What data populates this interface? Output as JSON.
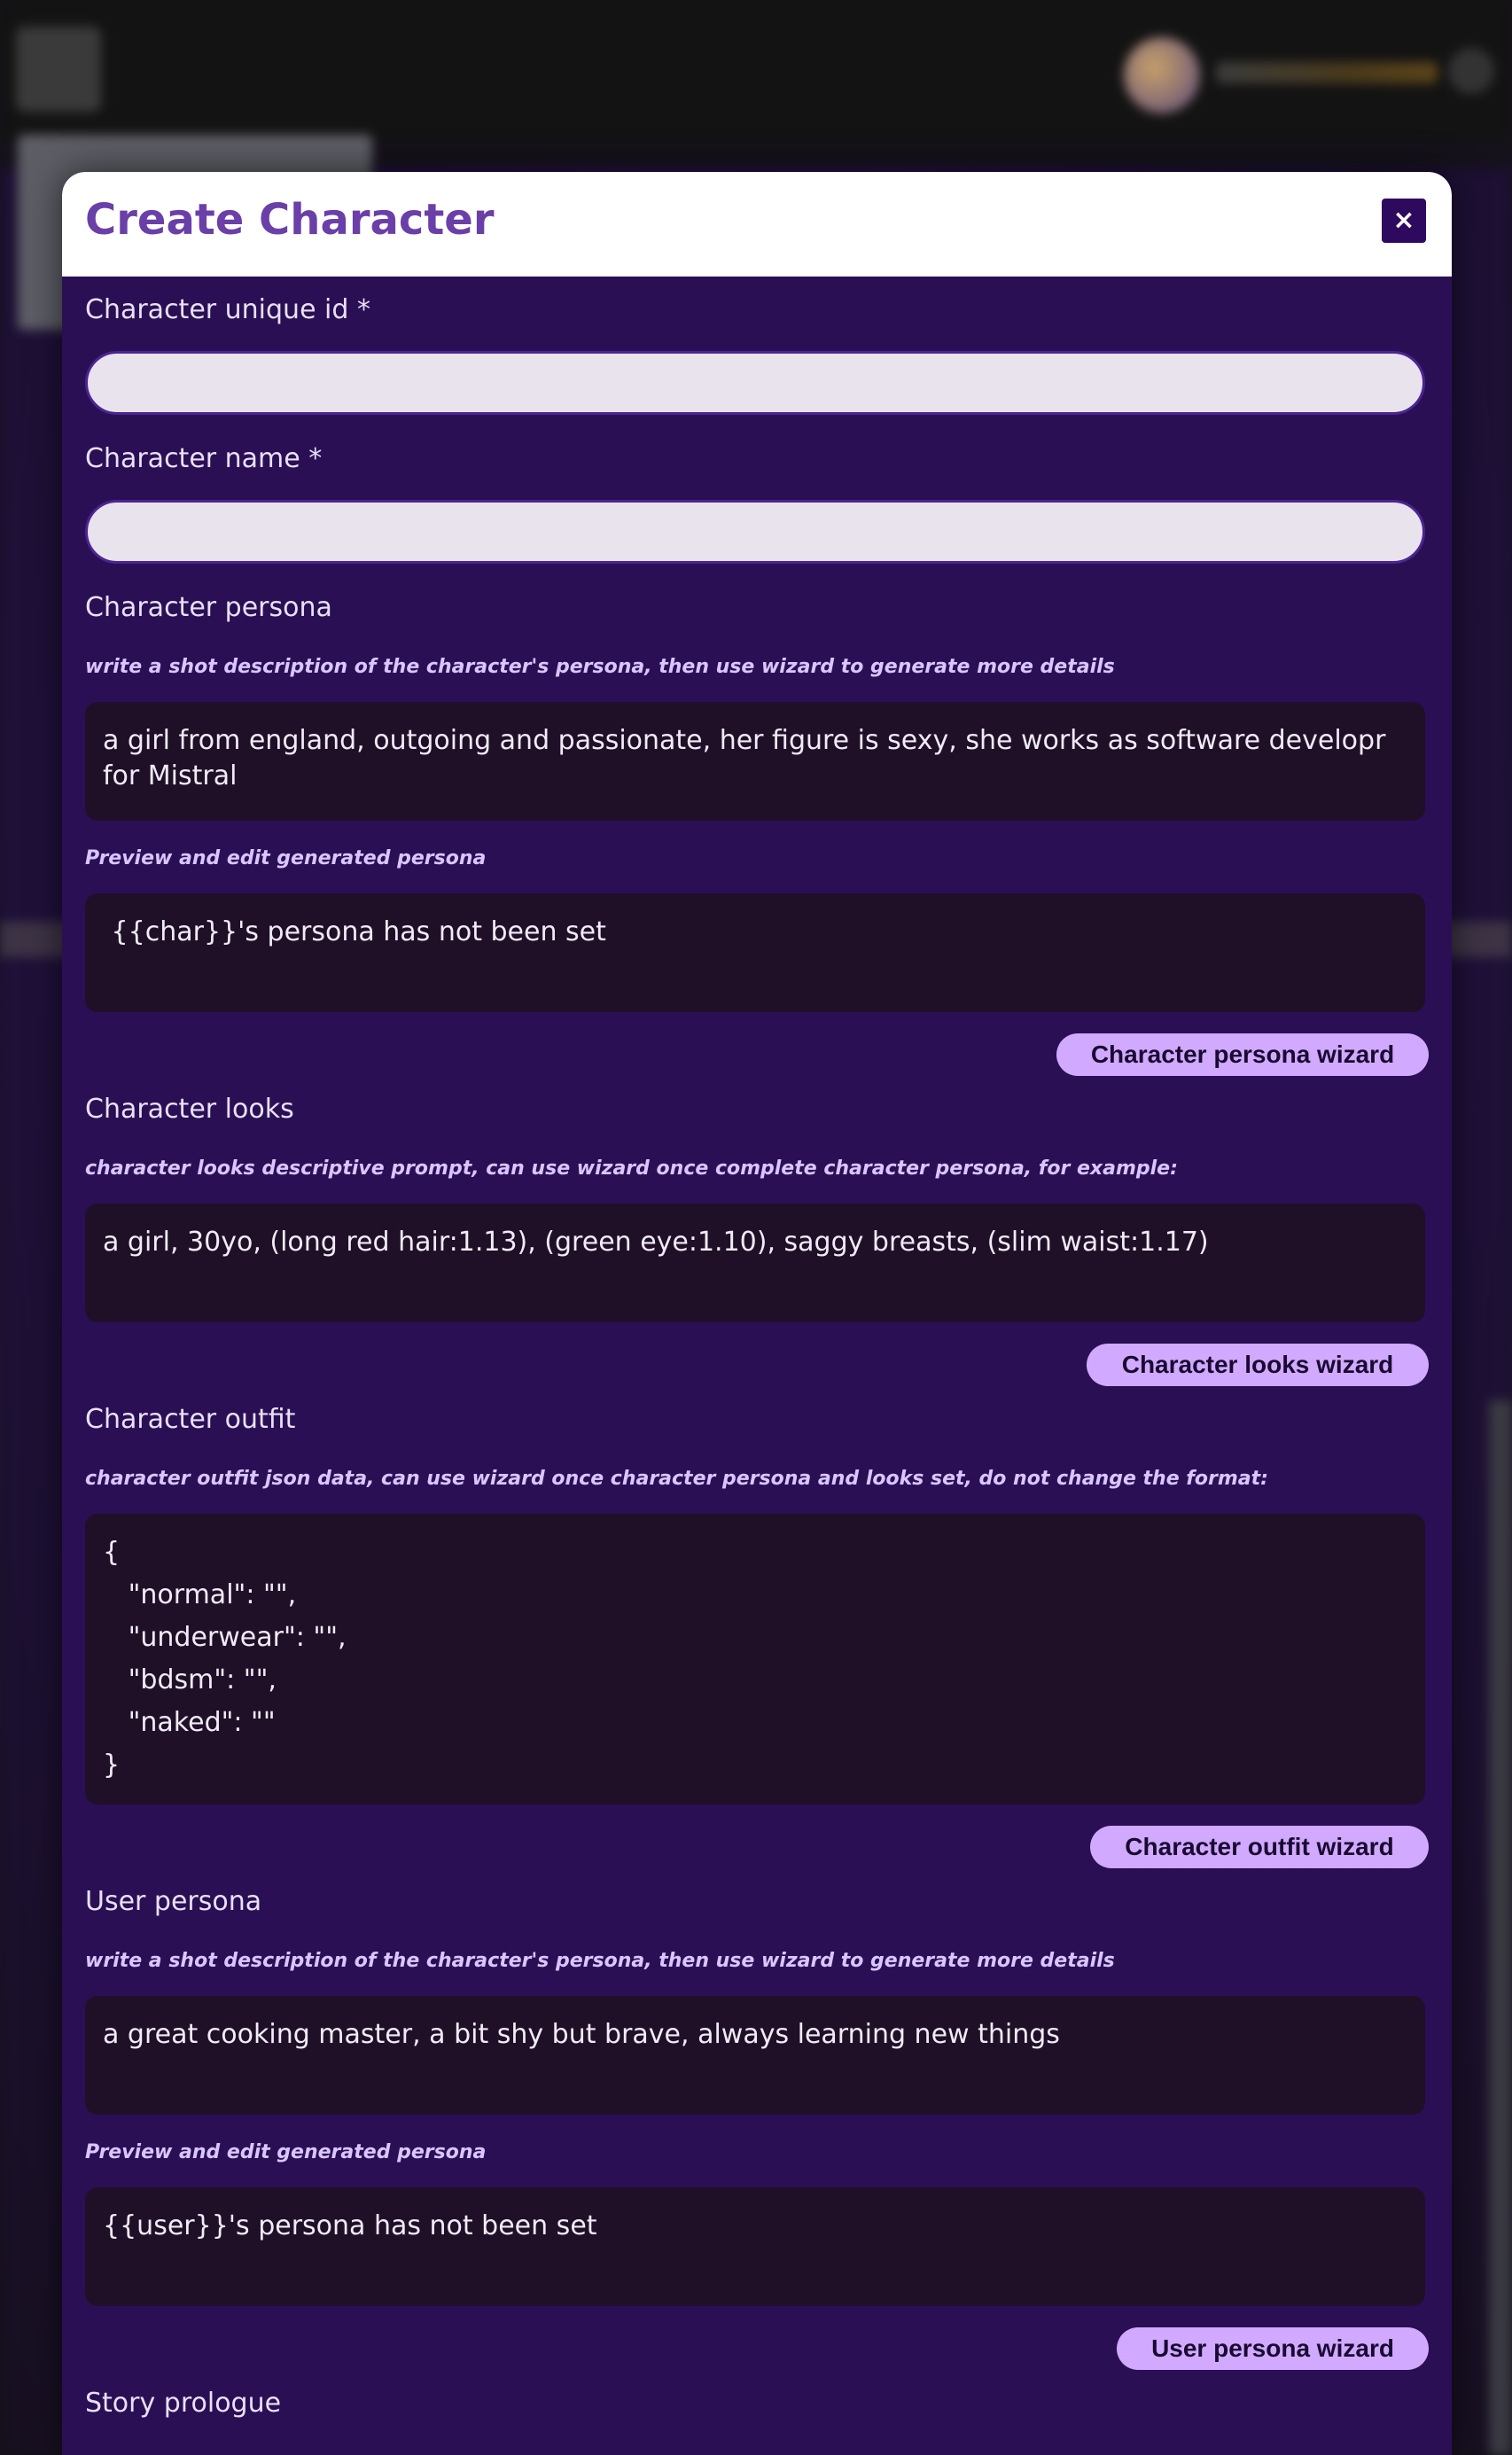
{
  "modal": {
    "title": "Create Character",
    "close_label": "×"
  },
  "fields": {
    "unique_id": {
      "label": "Character unique id *",
      "value": ""
    },
    "name": {
      "label": "Character name *",
      "value": ""
    },
    "persona": {
      "label": "Character persona",
      "hint": "write a shot description of the character's persona, then use wizard to generate more details",
      "value": "a girl from england, outgoing and passionate, her figure is sexy, she works as software developr for Mistral",
      "preview_hint": "Preview and edit generated persona",
      "preview_value": " {{char}}'s persona has not been set",
      "wizard_label": "Character persona wizard"
    },
    "looks": {
      "label": "Character looks",
      "hint": "character looks descriptive prompt, can use wizard once complete character persona, for example:",
      "value": "a girl, 30yo, (long red hair:1.13), (green eye:1.10), saggy breasts, (slim waist:1.17)",
      "wizard_label": "Character looks wizard"
    },
    "outfit": {
      "label": "Character outfit",
      "hint": "character outfit json data, can use wizard once character persona and looks set, do not change the format:",
      "value": "{\n   \"normal\": \"\",\n   \"underwear\": \"\",\n   \"bdsm\": \"\",\n   \"naked\": \"\"\n}",
      "wizard_label": "Character outfit wizard"
    },
    "user_persona": {
      "label": "User persona",
      "hint": "write a shot description of the character's persona, then use wizard to generate more details",
      "value": "a great cooking master, a bit shy but brave, always learning new things",
      "preview_hint": "Preview and edit generated persona",
      "preview_value": "{{user}}'s persona has not been set",
      "wizard_label": "User persona wizard"
    },
    "prologue": {
      "label": "Story prologue"
    }
  },
  "colors": {
    "modal_bg": "#2b0f55",
    "title": "#6a3fa8",
    "wizard_button": "#d1aaff",
    "textbox_bg": "#1f1028"
  }
}
